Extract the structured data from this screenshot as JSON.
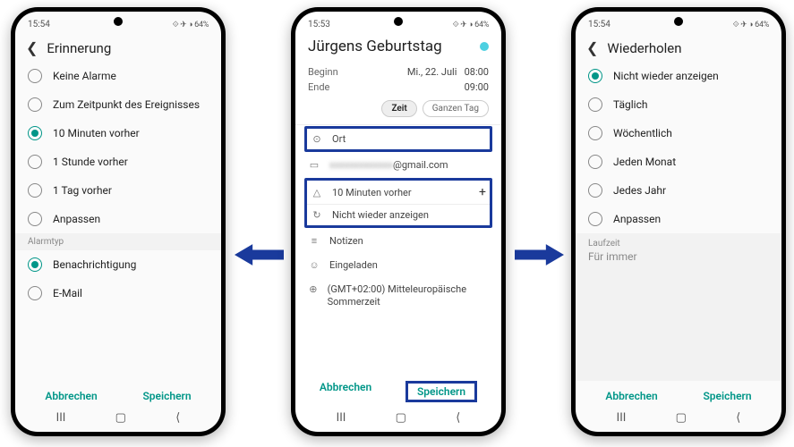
{
  "statusbar": {
    "time1": "15:54",
    "time2": "15:53",
    "time3": "15:54",
    "right": "⟐ ✈ ◑ 64%"
  },
  "reminder_screen": {
    "title": "Erinnerung",
    "options": [
      "Keine Alarme",
      "Zum Zeitpunkt des Ereignisses",
      "10 Minuten vorher",
      "1 Stunde vorher",
      "1 Tag vorher",
      "Anpassen"
    ],
    "selected_option_index": 2,
    "alarmtype_label": "Alarmtyp",
    "alarmtype_options": [
      "Benachrichtigung",
      "E-Mail"
    ],
    "alarmtype_selected_index": 0
  },
  "event_screen": {
    "title": "Jürgens Geburtstag",
    "begin_label": "Beginn",
    "begin_date": "Mi., 22. Juli",
    "begin_time": "08:00",
    "end_label": "Ende",
    "end_time": "09:00",
    "pill_time": "Zeit",
    "pill_allday": "Ganzen Tag",
    "location_label": "Ort",
    "account_suffix": "@gmail.com",
    "reminder": "10 Minuten vorher",
    "repeat": "Nicht wieder anzeigen",
    "notes": "Notizen",
    "invited": "Eingeladen",
    "timezone": "(GMT+02:00) Mitteleuropäische Sommerzeit"
  },
  "repeat_screen": {
    "title": "Wiederholen",
    "options": [
      "Nicht wieder anzeigen",
      "Täglich",
      "Wöchentlich",
      "Jeden Monat",
      "Jedes Jahr",
      "Anpassen"
    ],
    "selected_option_index": 0,
    "runtime_label": "Laufzeit",
    "runtime_value": "Für immer"
  },
  "actions": {
    "cancel": "Abbrechen",
    "save": "Speichern"
  },
  "nav": {
    "recents": "III",
    "home": "▢",
    "back": "⟨"
  },
  "colors": {
    "accent": "#009688",
    "highlight": "#1a3a9c"
  }
}
